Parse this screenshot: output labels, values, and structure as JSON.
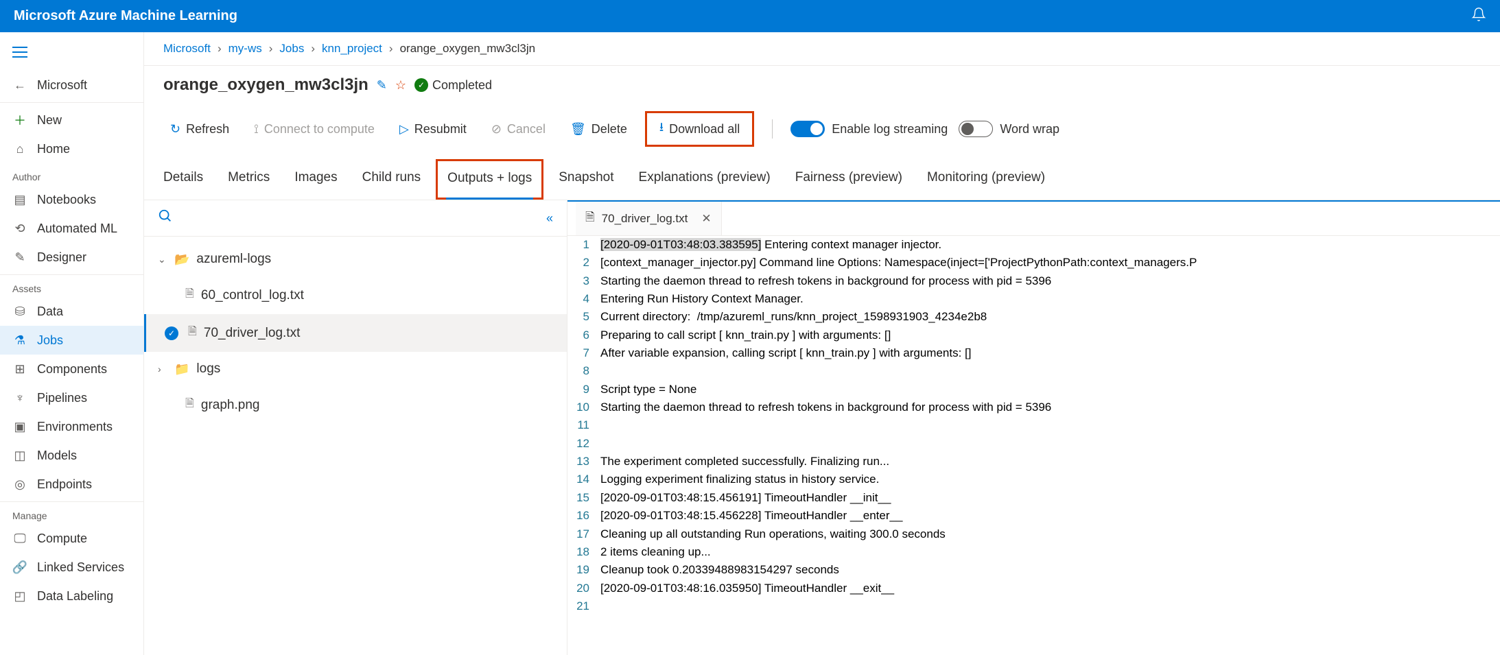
{
  "topbar": {
    "title": "Microsoft Azure Machine Learning"
  },
  "sidebar": {
    "back_label": "Microsoft",
    "new_label": "New",
    "home_label": "Home",
    "sections": {
      "author": "Author",
      "assets": "Assets",
      "manage": "Manage"
    },
    "items": {
      "notebooks": "Notebooks",
      "automl": "Automated ML",
      "designer": "Designer",
      "data": "Data",
      "jobs": "Jobs",
      "components": "Components",
      "pipelines": "Pipelines",
      "environments": "Environments",
      "models": "Models",
      "endpoints": "Endpoints",
      "compute": "Compute",
      "linked": "Linked Services",
      "labeling": "Data Labeling"
    }
  },
  "breadcrumb": {
    "items": [
      "Microsoft",
      "my-ws",
      "Jobs",
      "knn_project"
    ],
    "current": "orange_oxygen_mw3cl3jn"
  },
  "page_title": "orange_oxygen_mw3cl3jn",
  "status": "Completed",
  "toolbar": {
    "refresh": "Refresh",
    "connect": "Connect to compute",
    "resubmit": "Resubmit",
    "cancel": "Cancel",
    "delete": "Delete",
    "download": "Download all",
    "log_stream": "Enable log streaming",
    "word_wrap": "Word wrap"
  },
  "tabs": {
    "details": "Details",
    "metrics": "Metrics",
    "images": "Images",
    "child": "Child runs",
    "outputs": "Outputs + logs",
    "snapshot": "Snapshot",
    "explanations": "Explanations (preview)",
    "fairness": "Fairness (preview)",
    "monitoring": "Monitoring (preview)"
  },
  "file_tree": {
    "folder_aml": "azureml-logs",
    "file_60": "60_control_log.txt",
    "file_70": "70_driver_log.txt",
    "folder_logs": "logs",
    "file_graph": "graph.png"
  },
  "log_tab": "70_driver_log.txt",
  "log_lines": [
    "[2020-09-01T03:48:03.383595] Entering context manager injector.",
    "[context_manager_injector.py] Command line Options: Namespace(inject=['ProjectPythonPath:context_managers.P",
    "Starting the daemon thread to refresh tokens in background for process with pid = 5396",
    "Entering Run History Context Manager.",
    "Current directory:  /tmp/azureml_runs/knn_project_1598931903_4234e2b8",
    "Preparing to call script [ knn_train.py ] with arguments: []",
    "After variable expansion, calling script [ knn_train.py ] with arguments: []",
    "",
    "Script type = None",
    "Starting the daemon thread to refresh tokens in background for process with pid = 5396",
    "",
    "",
    "The experiment completed successfully. Finalizing run...",
    "Logging experiment finalizing status in history service.",
    "[2020-09-01T03:48:15.456191] TimeoutHandler __init__",
    "[2020-09-01T03:48:15.456228] TimeoutHandler __enter__",
    "Cleaning up all outstanding Run operations, waiting 300.0 seconds",
    "2 items cleaning up...",
    "Cleanup took 0.20339488983154297 seconds",
    "[2020-09-01T03:48:16.035950] TimeoutHandler __exit__",
    ""
  ]
}
